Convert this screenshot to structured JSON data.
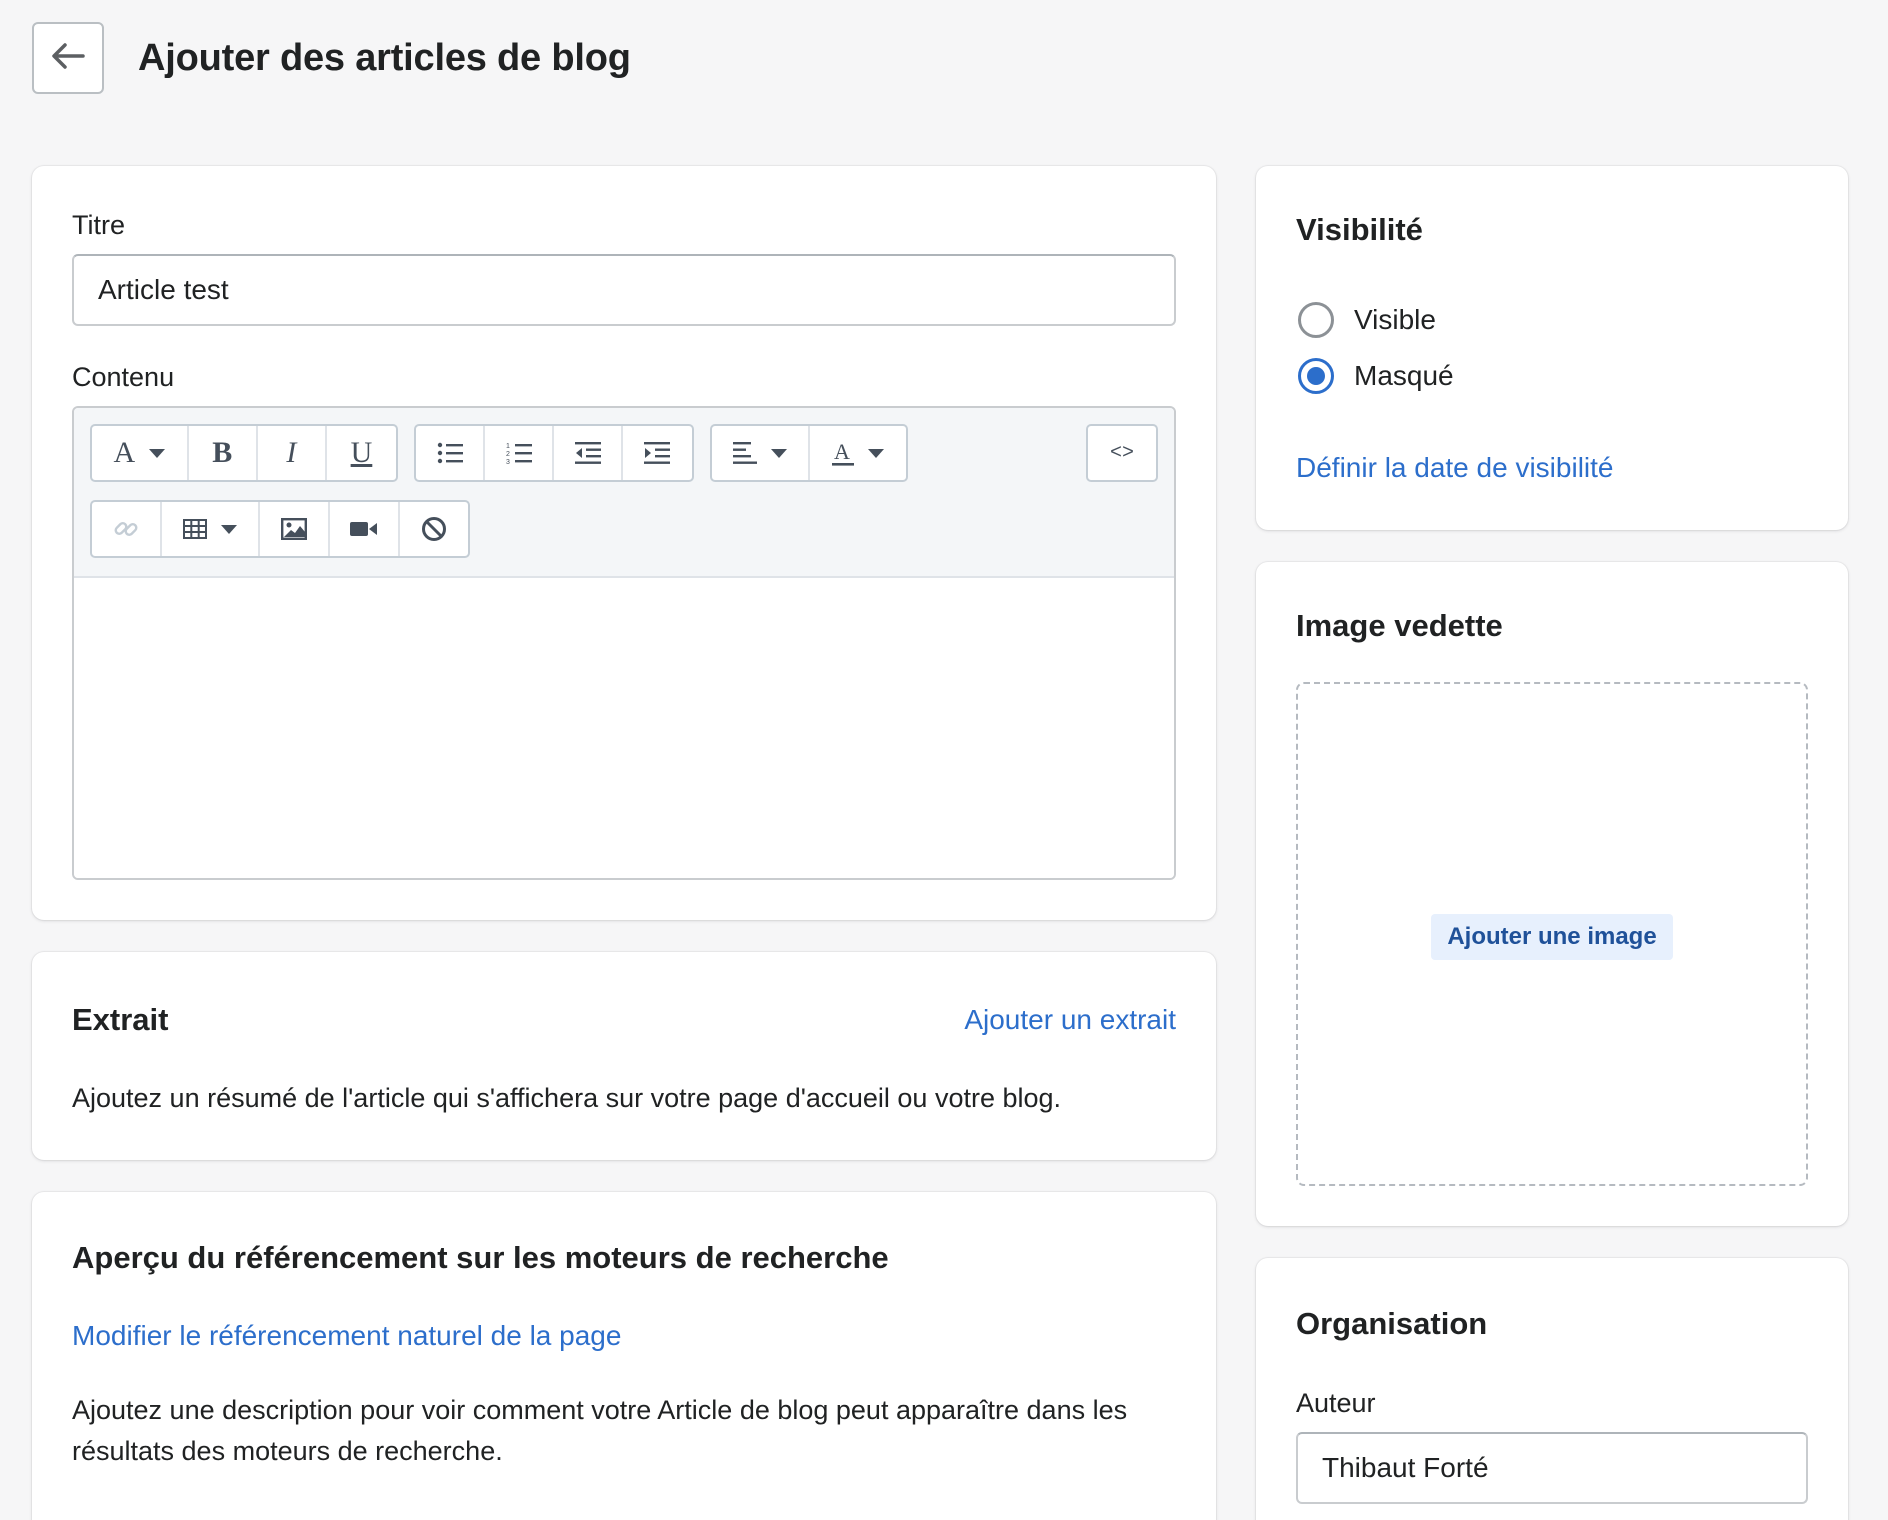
{
  "header": {
    "title": "Ajouter des articles de blog",
    "back_icon": "arrow-left-icon"
  },
  "main": {
    "title_label": "Titre",
    "title_value": "Article test",
    "content_label": "Contenu",
    "toolbar": {
      "row1": [
        "font-style-icon",
        "bold-icon",
        "italic-icon",
        "underline-icon",
        "bullet-list-icon",
        "numbered-list-icon",
        "outdent-icon",
        "indent-icon",
        "align-icon",
        "text-color-icon",
        "code-view-icon"
      ],
      "row2": [
        "link-icon",
        "table-icon",
        "image-icon",
        "video-icon",
        "clear-format-icon"
      ],
      "code_glyph": "<>"
    },
    "editor_body": ""
  },
  "excerpt": {
    "heading": "Extrait",
    "action": "Ajouter un extrait",
    "description": "Ajoutez un résumé de l'article qui s'affichera sur votre page d'accueil ou votre blog."
  },
  "seo": {
    "heading": "Aperçu du référencement sur les moteurs de recherche",
    "action": "Modifier le référencement naturel de la page",
    "description": "Ajoutez une description pour voir comment votre Article de blog peut apparaître dans les résultats des moteurs de recherche."
  },
  "visibility": {
    "heading": "Visibilité",
    "options": [
      {
        "label": "Visible",
        "checked": false
      },
      {
        "label": "Masqué",
        "checked": true
      }
    ],
    "action": "Définir la date de visibilité"
  },
  "featured_image": {
    "heading": "Image vedette",
    "button": "Ajouter une image"
  },
  "organization": {
    "heading": "Organisation",
    "author_label": "Auteur",
    "author_value": "Thibaut Forté"
  },
  "colors": {
    "background": "#f6f6f7",
    "link": "#2c6ecb",
    "radio_checked": "#2c6ecb",
    "image_button_bg": "#e7f0fd",
    "image_button_text": "#1f5199"
  }
}
